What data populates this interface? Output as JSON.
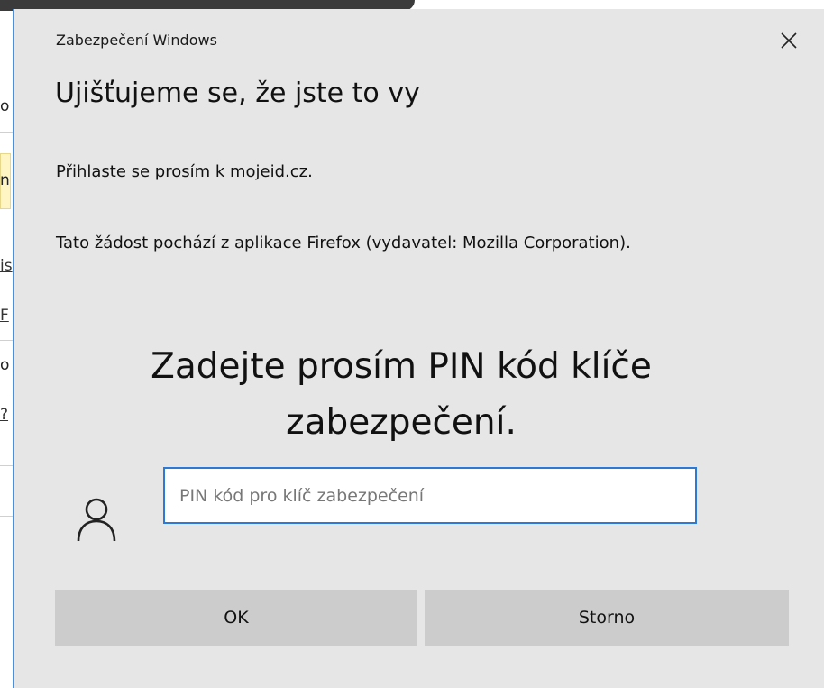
{
  "background_window": {
    "rows": [
      {
        "text": "o",
        "style": "plain"
      },
      {
        "text": "n",
        "style": "plain"
      },
      {
        "text": "is",
        "style": "link"
      },
      {
        "text": "F",
        "style": "link"
      },
      {
        "text": "o",
        "style": "plain"
      },
      {
        "text": "?",
        "style": "link"
      }
    ]
  },
  "dialog": {
    "title": "Zabezpečení Windows",
    "close_glyph": "✕",
    "heading": "Ujišťujeme se, že jste to vy",
    "sign_in_text": "Přihlaste se prosím k mojeid.cz.",
    "request_source_text": "Tato žádost pochází z aplikace Firefox (vydavatel: Mozilla Corporation).",
    "pin_prompt": "Zadejte prosím PIN kód klíče zabezpečení.",
    "pin_input": {
      "value": "",
      "placeholder": "PIN kód pro klíč zabezpečení"
    },
    "buttons": {
      "ok_label": "OK",
      "cancel_label": "Storno"
    }
  },
  "icons": {
    "close": "close-icon",
    "user": "user-icon"
  },
  "colors": {
    "dialog_background": "#e6e6e6",
    "accent_border": "#2d7ad6",
    "button_background": "#cccccc"
  }
}
